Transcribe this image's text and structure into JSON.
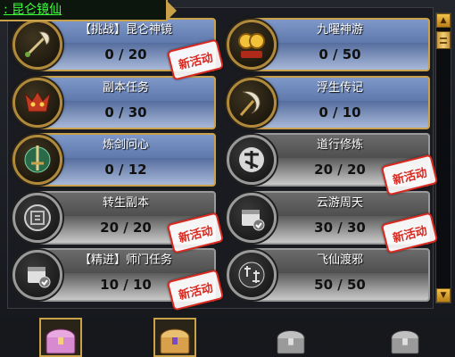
{
  "tooltip": {
    "prefix": ": ",
    "text": "昆仑镜仙"
  },
  "new_stamp": "新活动",
  "colors": {
    "gold_border": "#c9a14a",
    "blue_plate": "#6a84b8",
    "gray_plate": "#5a5a5a",
    "stamp_red": "#d8281f",
    "tooltip_green": "#3cff3c"
  },
  "cards": [
    {
      "title": "【挑战】昆仑神镜",
      "progress": "0 / 20",
      "style": "blue",
      "new": true,
      "icon": "axe-icon"
    },
    {
      "title": "九曜神游",
      "progress": "0 / 50",
      "style": "blue",
      "new": false,
      "icon": "gold-coins-icon"
    },
    {
      "title": "副本任务",
      "progress": "0 / 30",
      "style": "blue",
      "new": false,
      "icon": "demon-mask-icon"
    },
    {
      "title": "浮生传记",
      "progress": "0 / 10",
      "style": "blue",
      "new": false,
      "icon": "crescent-blade-icon"
    },
    {
      "title": "炼剑问心",
      "progress": "0 / 12",
      "style": "blue",
      "new": false,
      "icon": "jade-sword-icon"
    },
    {
      "title": "道行修炼",
      "progress": "20 / 20",
      "style": "gray",
      "new": true,
      "icon": "dao-calligraphy-icon"
    },
    {
      "title": "转生副本",
      "progress": "20 / 20",
      "style": "gray",
      "new": true,
      "icon": "reincarnation-seal-icon"
    },
    {
      "title": "云游周天",
      "progress": "30 / 30",
      "style": "gray",
      "new": true,
      "icon": "calendar-check-icon"
    },
    {
      "title": "【精进】师门任务",
      "progress": "10 / 10",
      "style": "gray",
      "new": true,
      "icon": "calendar-check-icon"
    },
    {
      "title": "飞仙渡邪",
      "progress": "50 / 50",
      "style": "gray",
      "new": false,
      "icon": "dual-calligraphy-icon"
    }
  ],
  "chests": [
    {
      "icon": "pink-chest-icon",
      "state": "active"
    },
    {
      "icon": "gold-chest-icon",
      "state": "active"
    },
    {
      "icon": "silver-chest-icon",
      "state": "locked"
    },
    {
      "icon": "silver-chest-icon",
      "state": "locked"
    }
  ]
}
